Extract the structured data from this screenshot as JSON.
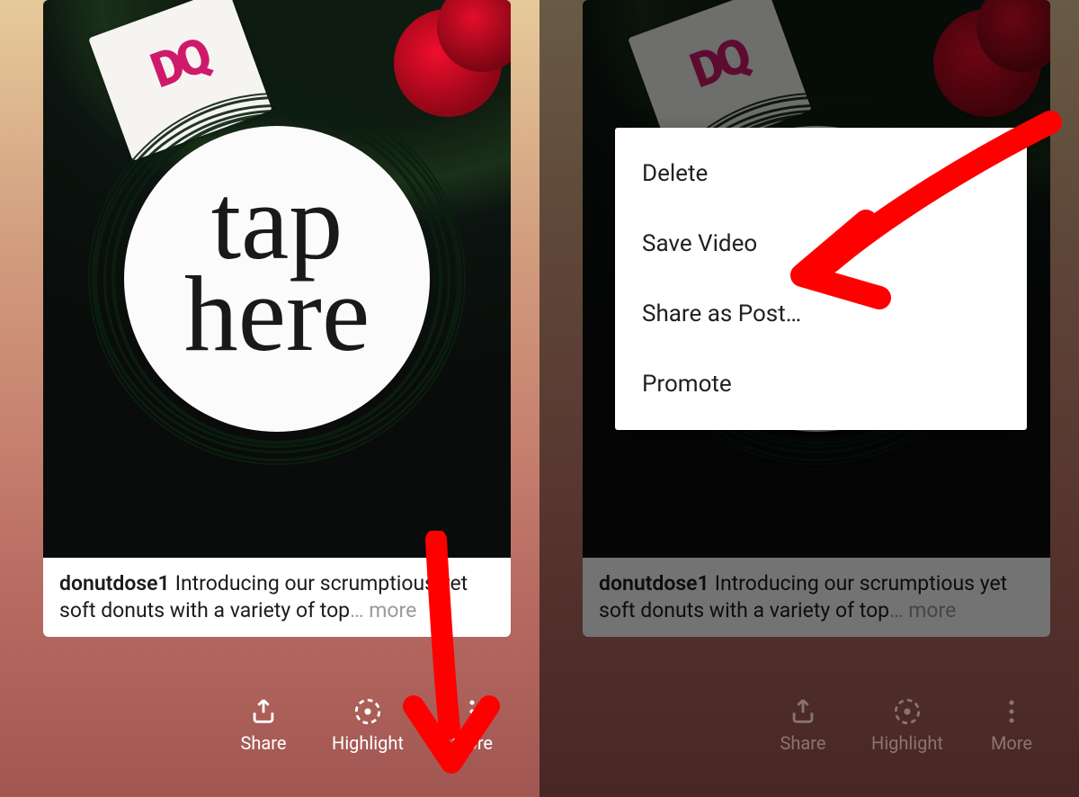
{
  "story": {
    "brand_text": "DQ",
    "overlay_line1": "tap",
    "overlay_line2": "here",
    "caption_user": "donutdose1",
    "caption_text": "Introducing our scrumptious yet soft donuts with a variety of top",
    "caption_more": "… more"
  },
  "toolbar": {
    "share": "Share",
    "highlight": "Highlight",
    "more": "More"
  },
  "menu": {
    "items": [
      "Delete",
      "Save Video",
      "Share as Post…",
      "Promote"
    ]
  }
}
